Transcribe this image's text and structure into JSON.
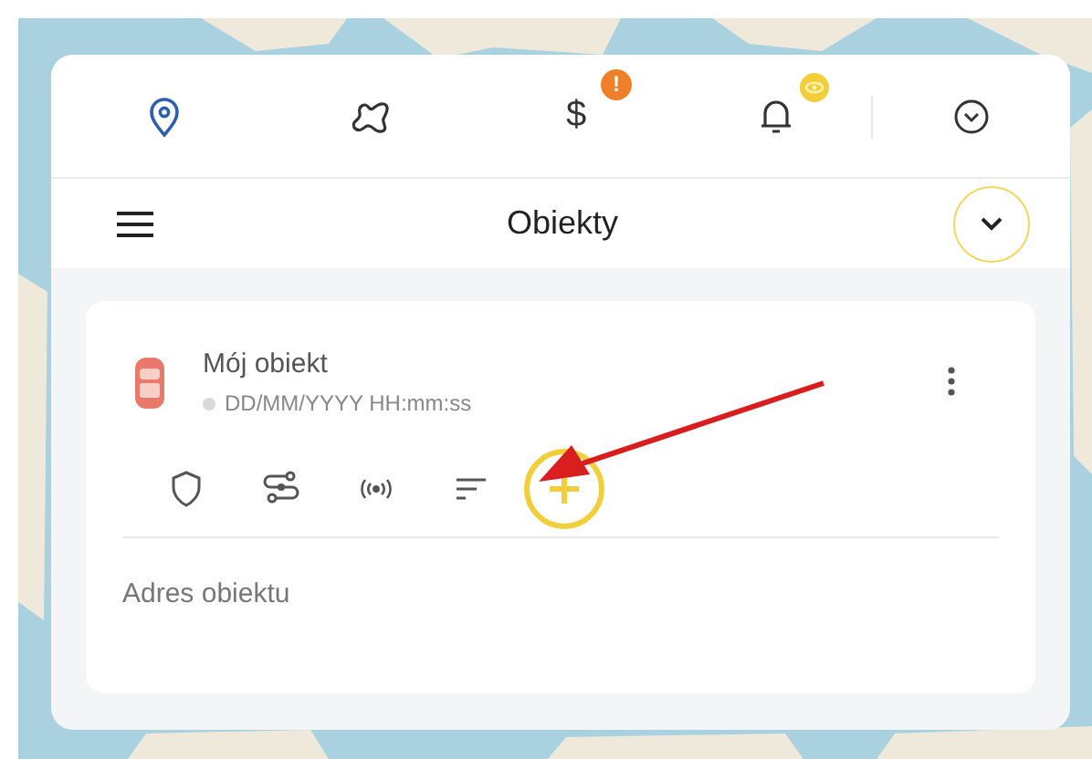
{
  "nav_tabs": [
    {
      "kind": "location",
      "selected": true
    },
    {
      "kind": "route",
      "selected": false
    },
    {
      "kind": "dollar",
      "symbol": "$",
      "selected": false,
      "badge": {
        "kind": "text",
        "text": "!",
        "color": "#f07f2a"
      }
    },
    {
      "kind": "bell",
      "selected": false,
      "badge": {
        "kind": "eye",
        "color": "#f2cf3a"
      }
    },
    {
      "kind": "chevron-circle",
      "selected": false
    }
  ],
  "header": {
    "title": "Obiekty"
  },
  "object_card": {
    "name": "Mój obiekt",
    "timestamp": "DD/MM/YYYY HH:mm:ss",
    "status_dot": {
      "color": "#d9d9d9"
    },
    "actions": [
      {
        "kind": "shield",
        "highlighted": false
      },
      {
        "kind": "route",
        "highlighted": false
      },
      {
        "kind": "signal",
        "highlighted": false
      },
      {
        "kind": "sort",
        "highlighted": false
      },
      {
        "kind": "plus",
        "highlighted": true
      }
    ],
    "address": "Adres obiektu"
  }
}
